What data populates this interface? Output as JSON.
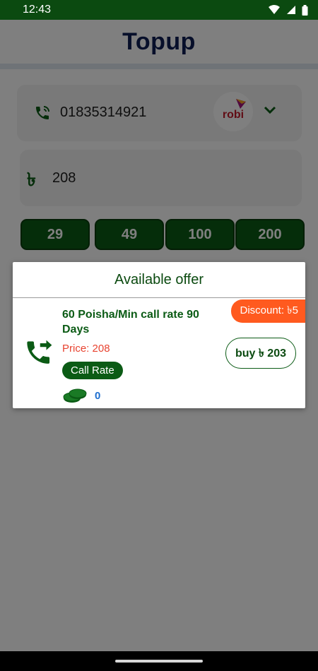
{
  "status_bar": {
    "time": "12:43"
  },
  "app": {
    "title": "Topup",
    "phone": {
      "number": "01835314921",
      "operator_logo_text": "robi"
    },
    "amount": {
      "value": "208",
      "currency_symbol": "৳"
    },
    "quick_amounts": [
      "29",
      "49",
      "100",
      "200"
    ]
  },
  "dialog": {
    "title": "Available offer",
    "offer": {
      "discount": "Discount: ৳5",
      "name": "60 Poisha/Min call rate 90 Days",
      "price": "Price: 208",
      "tag": "Call Rate",
      "coins": "0",
      "buy_label": "buy ৳ 203"
    }
  },
  "colors": {
    "primary_green": "#0b5b15",
    "status_bar": "#0b4a10",
    "title": "#0f1f55",
    "discount": "#ff5a1f",
    "price": "#e84330",
    "coins": "#1f6fcf"
  }
}
